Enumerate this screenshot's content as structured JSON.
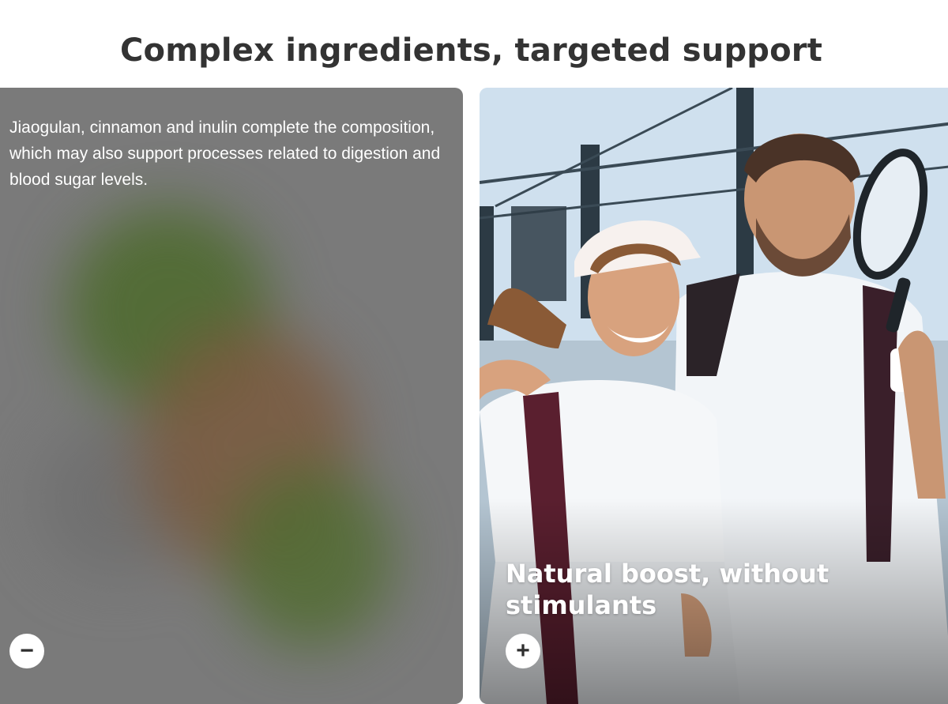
{
  "section": {
    "title": "Complex ingredients, targeted support"
  },
  "cards": [
    {
      "description": "Jiaogulan, cinnamon and inulin complete the composition, which may also support processes related to digestion and blood sugar levels.",
      "toggle_symbol": "−",
      "toggle_icon": "minus-icon",
      "state": "expanded"
    },
    {
      "heading": "Natural boost, without stimulants",
      "toggle_symbol": "+",
      "toggle_icon": "plus-icon",
      "state": "collapsed",
      "image": "people-playing-padel-photo"
    }
  ]
}
